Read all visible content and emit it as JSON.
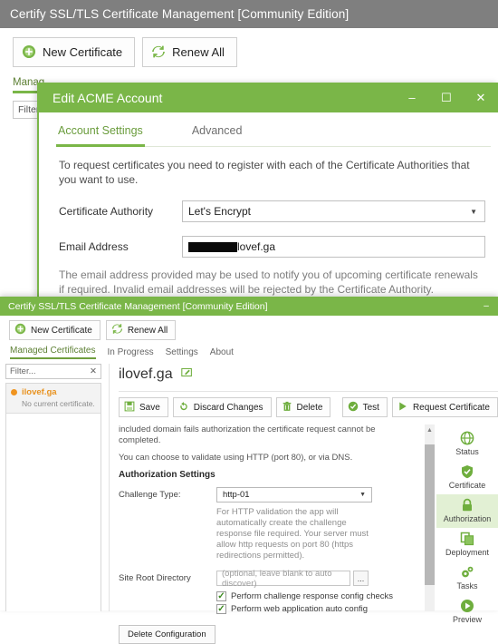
{
  "window_back": {
    "title": "Certify SSL/TLS Certificate Management [Community Edition]",
    "titlebar_color": "#7f7f7f",
    "toolbar": {
      "new_certificate": "New Certificate",
      "renew_all": "Renew All"
    },
    "tabs": [
      {
        "label": "Manag",
        "active": true
      }
    ],
    "filter_placeholder": "Filter."
  },
  "dialog": {
    "title": "Edit ACME Account",
    "accent_color": "#7ab648",
    "window_controls": {
      "minimize": "–",
      "maximize": "☐",
      "close": "✕"
    },
    "tabs": [
      {
        "label": "Account Settings",
        "active": true
      },
      {
        "label": "Advanced",
        "active": false
      }
    ],
    "intro": "To request certificates you need to register with each of the Certificate Authorities that you want to use.",
    "fields": {
      "certificate_authority_label": "Certificate Authority",
      "certificate_authority_value": "Let's Encrypt",
      "email_label": "Email Address",
      "email_value_visible": "lovef.ga",
      "email_redacted": true
    },
    "help_text": "The email address provided may be used to notify you of upcoming certificate renewals if required. Invalid email addresses will be rejected by the Certificate Authority."
  },
  "window_front": {
    "title": "Certify SSL/TLS Certificate Management [Community Edition]",
    "titlebar_color": "#7ab648",
    "window_controls": {
      "minimize": "–"
    },
    "toolbar": {
      "new_certificate": "New Certificate",
      "renew_all": "Renew All"
    },
    "tabs": [
      {
        "label": "Managed Certificates",
        "active": true
      },
      {
        "label": "In Progress",
        "active": false
      },
      {
        "label": "Settings",
        "active": false
      },
      {
        "label": "About",
        "active": false
      }
    ],
    "filter": {
      "placeholder": "Filter...",
      "clear_glyph": "✕"
    },
    "cert_list": [
      {
        "name": "ilovef.ga",
        "status": "No current certificate.",
        "status_color": "#f0941f"
      }
    ],
    "detail": {
      "domain_title": "ilovef.ga",
      "edit_glyph": "✎",
      "actions": {
        "save": "Save",
        "discard": "Discard Changes",
        "delete": "Delete",
        "test": "Test",
        "request_certificate": "Request Certificate"
      },
      "config": {
        "para1": "included domain fails authorization the certificate request cannot be completed.",
        "para2": "You can choose to validate using HTTP (port 80), or via DNS.",
        "section_title": "Authorization Settings",
        "challenge_type_label": "Challenge Type:",
        "challenge_type_value": "http-01",
        "challenge_hint": "For HTTP validation the app will automatically create the challenge response file required. Your server must allow http requests on port 80 (https redirections permitted).",
        "site_root_label": "Site Root Directory",
        "site_root_placeholder": "(optional, leave blank to auto discover)",
        "browse_glyph": "...",
        "checkbox1_label": "Perform challenge response config checks",
        "checkbox1_checked": true,
        "checkbox2_label": "Perform web application auto config",
        "checkbox2_checked": true,
        "delete_configuration": "Delete Configuration"
      },
      "rail": [
        {
          "label": "Status",
          "icon": "globe-icon",
          "active": false
        },
        {
          "label": "Certificate",
          "icon": "shield-icon",
          "active": false
        },
        {
          "label": "Authorization",
          "icon": "lock-icon",
          "active": true
        },
        {
          "label": "Deployment",
          "icon": "copy-icon",
          "active": false
        },
        {
          "label": "Tasks",
          "icon": "gears-icon",
          "active": false
        },
        {
          "label": "Preview",
          "icon": "play-icon",
          "active": false
        }
      ]
    }
  }
}
